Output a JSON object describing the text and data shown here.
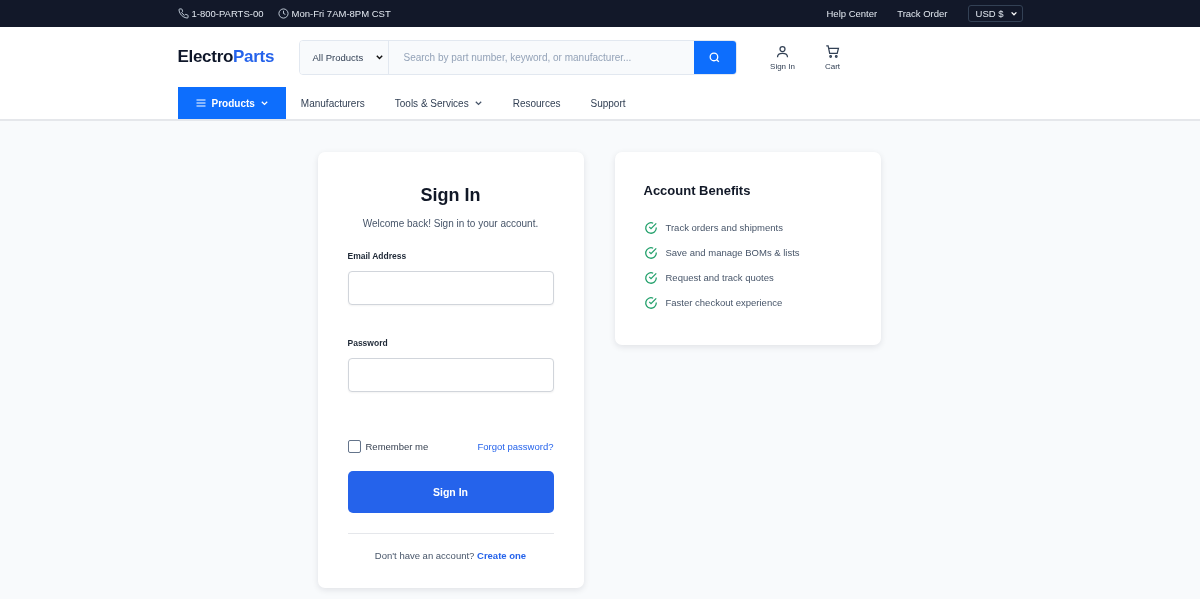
{
  "top_bar": {
    "phone": "1-800-PARTS-00",
    "hours": "Mon-Fri 7AM-8PM CST",
    "links": [
      "Help Center",
      "Track Order"
    ],
    "currency": "USD $"
  },
  "header": {
    "logo": {
      "first": "Electro",
      "second": "Parts"
    },
    "category": "All Products",
    "search": {
      "placeholder": "Search by part number, keyword, or manufacturer..."
    },
    "actions": [
      {
        "kind": "user",
        "label": "Sign In"
      },
      {
        "kind": "cart",
        "label": "Cart"
      }
    ]
  },
  "nav": [
    {
      "label": "Products",
      "selected": true,
      "has_menu": true
    },
    {
      "label": "Manufacturers",
      "selected": false,
      "has_menu": false
    },
    {
      "label": "Tools & Services",
      "selected": false,
      "has_menu": true
    },
    {
      "label": "Resources",
      "selected": false,
      "has_menu": false
    },
    {
      "label": "Support",
      "selected": false,
      "has_menu": false
    }
  ],
  "sign_in": {
    "title": "Sign In",
    "subtitle": "Welcome back! Sign in to your account.",
    "fields": [
      {
        "label": "Email Address"
      },
      {
        "label": "Password"
      }
    ],
    "remember": {
      "label": "Remember me",
      "checked": false
    },
    "forgot": "Forgot password?",
    "submit": "Sign In",
    "footer": {
      "text": "Don't have an account?",
      "link": "Create one"
    }
  },
  "benefits": {
    "title": "Account Benefits",
    "items": [
      "Track orders and shipments",
      "Save and manage BOMs & lists",
      "Request and track quotes",
      "Faster checkout experience"
    ]
  }
}
